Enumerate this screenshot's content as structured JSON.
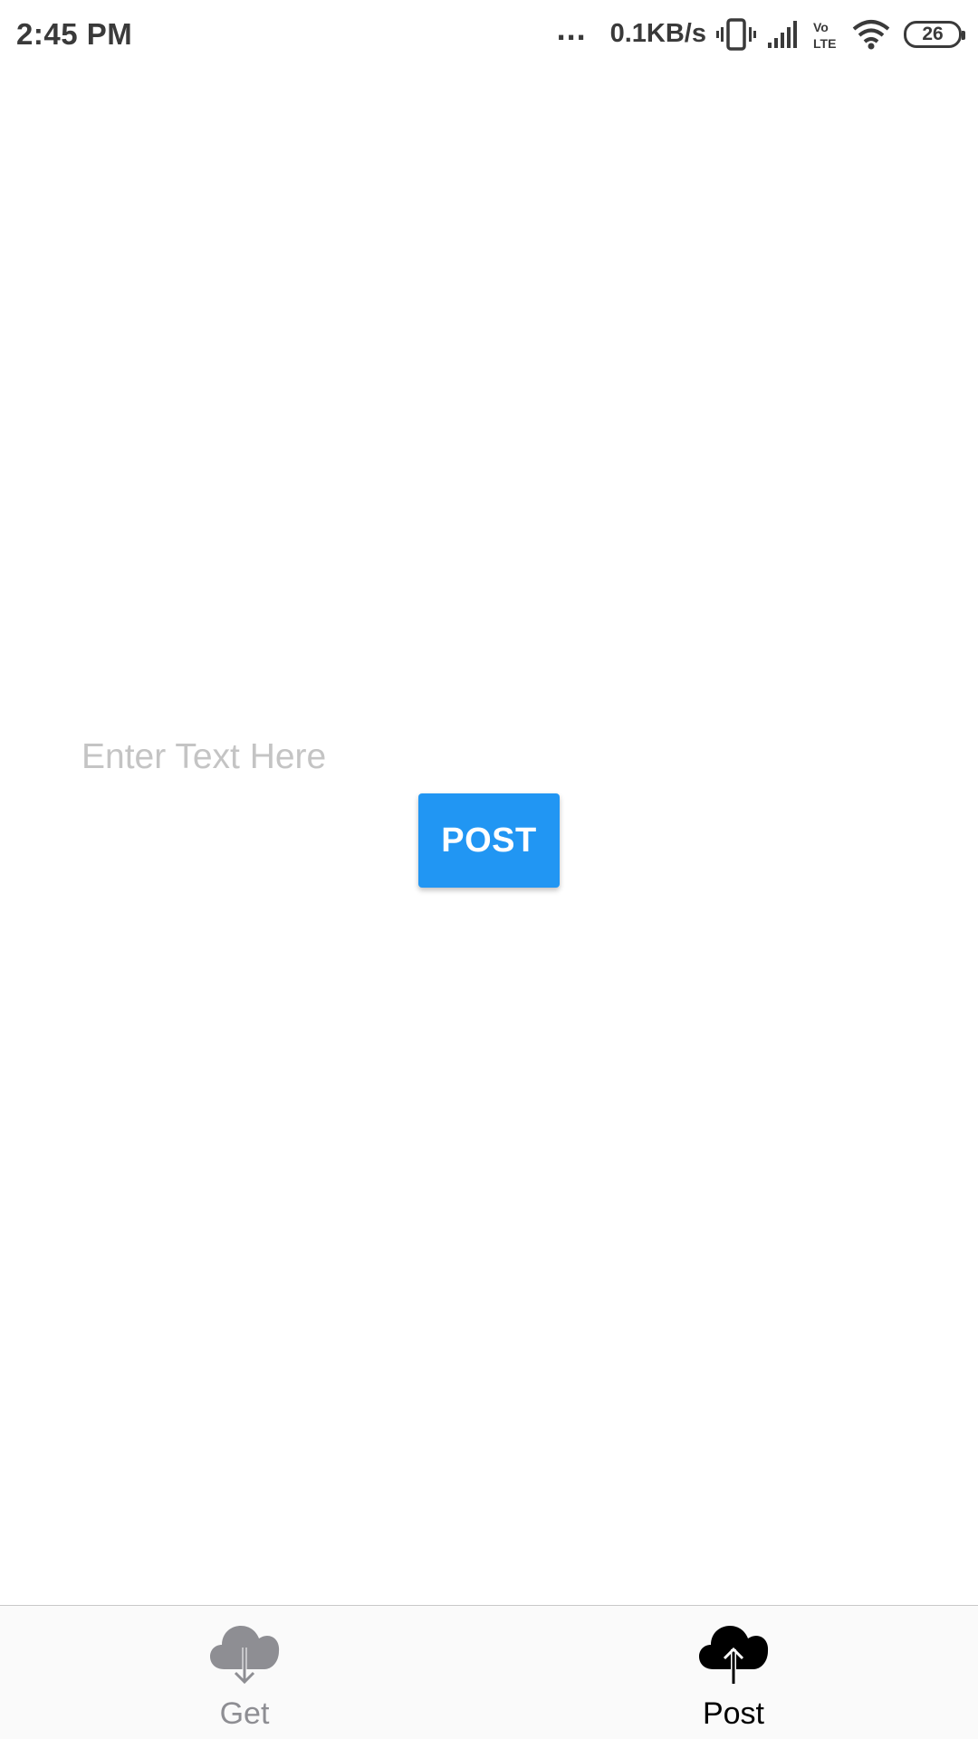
{
  "status_bar": {
    "time": "2:45 PM",
    "dots": "...",
    "network_speed": "0.1KB/s",
    "volte_label_top": "Vo",
    "volte_label_bottom": "LTE",
    "battery_level": "26",
    "icons": [
      "vibrate-icon",
      "signal-icon",
      "volte-icon",
      "wifi-icon",
      "battery-icon"
    ]
  },
  "main": {
    "input": {
      "placeholder": "Enter Text Here",
      "value": ""
    },
    "post_button_label": "POST"
  },
  "tab_bar": {
    "tabs": [
      {
        "label": "Get",
        "icon": "cloud-download-icon",
        "active": false
      },
      {
        "label": "Post",
        "icon": "cloud-upload-icon",
        "active": true
      }
    ]
  },
  "colors": {
    "accent": "#2196f3",
    "tab_inactive": "#8e8e93",
    "tab_active": "#000000",
    "placeholder": "#c4c4c4",
    "status_text": "#3a3a3a"
  }
}
